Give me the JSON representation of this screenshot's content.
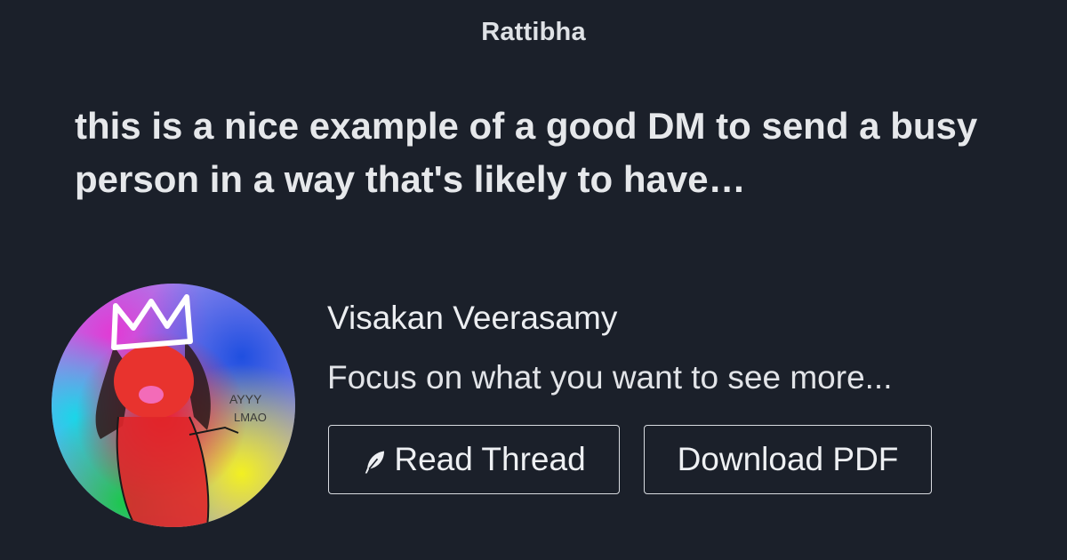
{
  "site": {
    "brand": "Rattibha"
  },
  "thread": {
    "headline": "this is a nice example of a good DM to send a busy person in a way that's likely to have…"
  },
  "author": {
    "name": "Visakan Veerasamy",
    "bio": "Focus on what you want to see more...",
    "avatar_icon": "avatar-illustration",
    "avatar_text": "AYYY LMAO"
  },
  "actions": {
    "read_label": "Read Thread",
    "read_icon": "feather-icon",
    "pdf_label": "Download PDF"
  },
  "colors": {
    "background": "#1b202a",
    "text": "#e9ebee",
    "button_border": "#d8dbe0"
  }
}
